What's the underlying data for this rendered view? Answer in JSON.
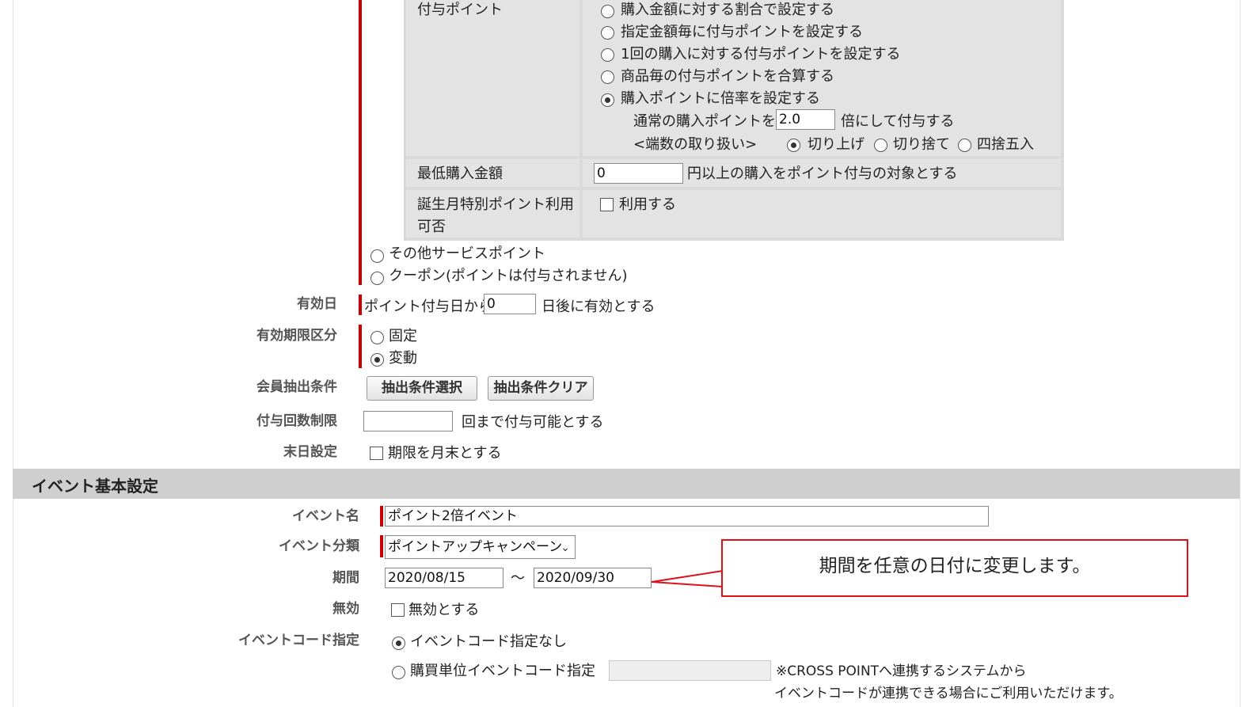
{
  "points_table": {
    "award_points": {
      "label": "付与ポイント",
      "options": [
        "購入金額に対する割合で設定する",
        "指定金額毎に付与ポイントを設定する",
        "1回の購入に対する付与ポイントを設定する",
        "商品毎の付与ポイントを合算する",
        "購入ポイントに倍率を設定する"
      ],
      "selected_index": 4,
      "multiplier_prefix": "通常の購入ポイントを",
      "multiplier_value": "2.0",
      "multiplier_suffix": "倍にして付与する",
      "rounding_label": "<端数の取り扱い>",
      "rounding_options": [
        "切り上げ",
        "切り捨て",
        "四捨五入"
      ],
      "rounding_selected": 0
    },
    "min_purchase": {
      "label": "最低購入金額",
      "value": "0",
      "suffix": "円以上の購入をポイント付与の対象とする"
    },
    "birthday": {
      "label_line1": "誕生月特別ポイント利用",
      "label_line2": "可否",
      "checkbox_label": "利用する"
    }
  },
  "point_type": {
    "other_service": "その他サービスポイント",
    "coupon": "クーポン(ポイントは付与されません)"
  },
  "valid_day": {
    "label": "有効日",
    "prefix": "ポイント付与日から",
    "value": "0",
    "suffix": "日後に有効とする"
  },
  "expiry_type": {
    "label": "有効期限区分",
    "fixed": "固定",
    "variable": "変動"
  },
  "member_filter": {
    "label": "会員抽出条件",
    "select_button": "抽出条件選択",
    "clear_button": "抽出条件クリア"
  },
  "award_limit": {
    "label": "付与回数制限",
    "value": "",
    "suffix": "回まで付与可能とする"
  },
  "end_day": {
    "label": "末日設定",
    "checkbox_label": "期限を月末とする"
  },
  "section_title": "イベント基本設定",
  "event_name": {
    "label": "イベント名",
    "value": "ポイント2倍イベント"
  },
  "event_category": {
    "label": "イベント分類",
    "value": "ポイントアップキャンペーン"
  },
  "period": {
    "label": "期間",
    "from": "2020/08/15",
    "separator": "〜",
    "to": "2020/09/30"
  },
  "disabled": {
    "label": "無効",
    "checkbox_label": "無効とする"
  },
  "event_code": {
    "label": "イベントコード指定",
    "none": "イベントコード指定なし",
    "purchase_unit": "購買単位イベントコード指定",
    "note_line1": "※CROSS POINTへ連携するシステムから",
    "note_line2": "イベントコードが連携できる場合にご利用いただけます。"
  },
  "callout_text": "期間を任意の日付に変更します。"
}
